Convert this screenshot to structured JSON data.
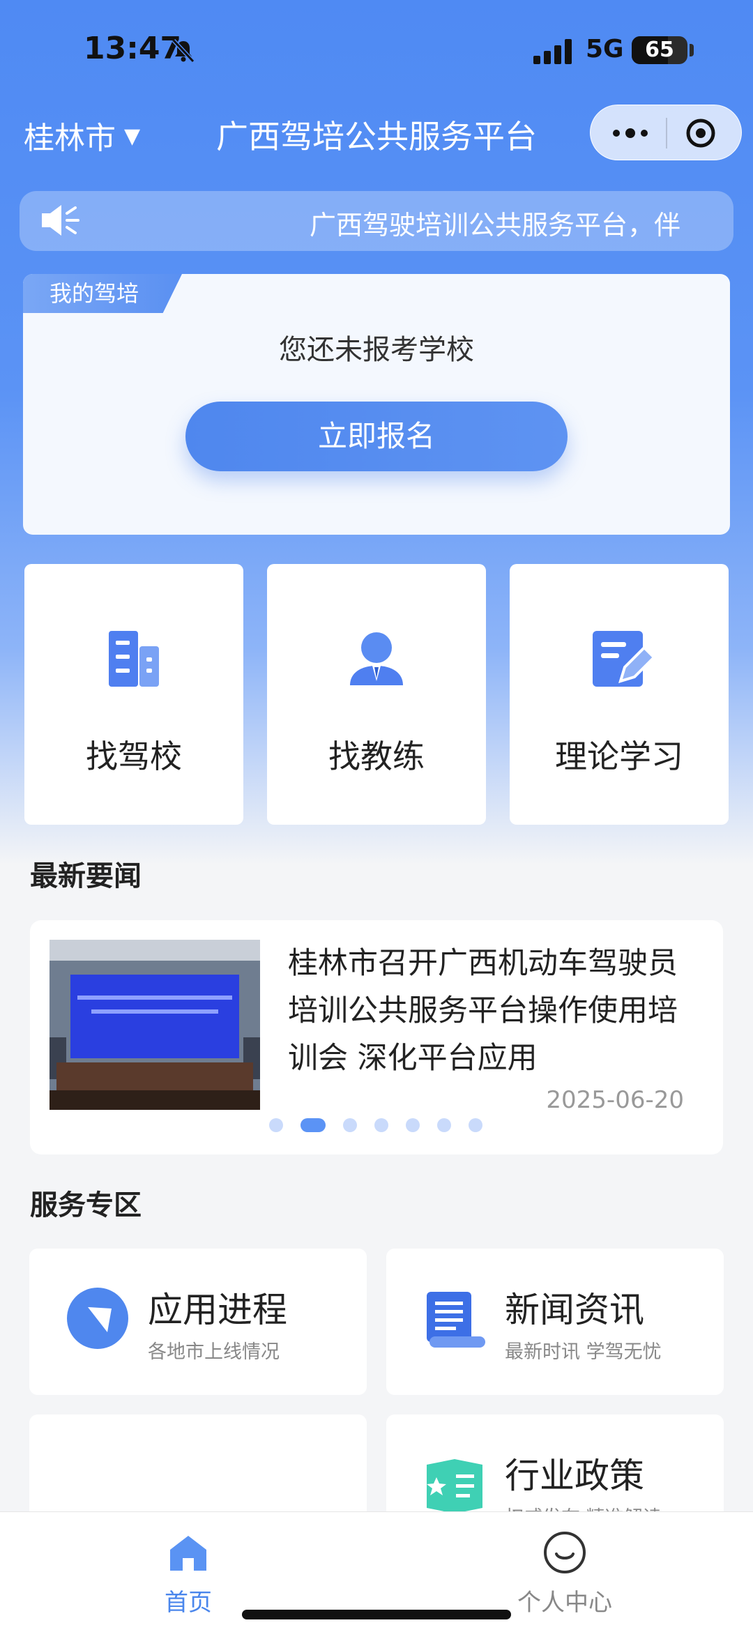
{
  "status_bar": {
    "time": "13:47",
    "network": "5G",
    "battery": "65",
    "battery_level": 0.65
  },
  "nav": {
    "city": "桂林市",
    "caret": "▼",
    "title": "广西驾培公共服务平台"
  },
  "notice": {
    "text": "广西驾驶培训公共服务平台，伴"
  },
  "my_training": {
    "tag": "我的驾培",
    "status": "您还未报考学校",
    "signup_button": "立即报名"
  },
  "features": [
    {
      "label": "找驾校",
      "icon": "building-icon"
    },
    {
      "label": "找教练",
      "icon": "coach-icon"
    },
    {
      "label": "理论学习",
      "icon": "study-edit-icon"
    }
  ],
  "news_section": {
    "title": "最新要闻",
    "item": {
      "headline": "桂林市召开广西机动车驾驶员培训公共服务平台操作使用培训会 深化平台应用",
      "date": "2025-06-20",
      "image_caption": "广西机动车驾驶员培训公共服务平台操作使用培训会"
    },
    "dots": 7,
    "active_dot": 2
  },
  "service_section": {
    "title": "服务专区",
    "items": [
      {
        "title": "应用进程",
        "subtitle": "各地市上线情况",
        "icon": "compass-icon"
      },
      {
        "title": "新闻资讯",
        "subtitle": "最新时讯 学驾无忧",
        "icon": "scroll-icon"
      },
      {
        "title": "",
        "subtitle": "",
        "icon": ""
      },
      {
        "title": "行业政策",
        "subtitle": "权威发布 精准解读",
        "icon": "policy-book-icon"
      }
    ]
  },
  "tabbar": {
    "items": [
      {
        "label": "首页",
        "icon": "home-icon",
        "active": true
      },
      {
        "label": "个人中心",
        "icon": "smile-icon",
        "active": false
      }
    ]
  },
  "colors": {
    "primary": "#5b93f5",
    "tab_active": "#4a86ec",
    "tab_inactive": "#888888"
  }
}
